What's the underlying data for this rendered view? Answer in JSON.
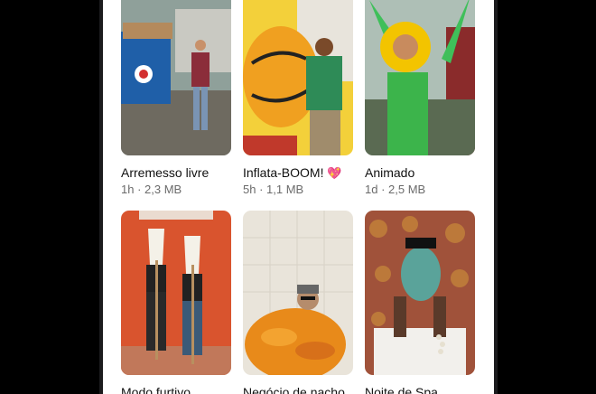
{
  "grid": {
    "items": [
      {
        "title": "Arremesso livre",
        "meta": "1h · 2,3 MB"
      },
      {
        "title": "Inflata-BOOM!",
        "emoji": "💖",
        "meta": "5h · 1,1 MB"
      },
      {
        "title": "Animado",
        "meta": "1d · 2,5 MB"
      },
      {
        "title": "Modo furtivo",
        "meta": ""
      },
      {
        "title": "Negócio de nacho",
        "meta": ""
      },
      {
        "title": "Noite de Spa",
        "meta": ""
      }
    ]
  }
}
